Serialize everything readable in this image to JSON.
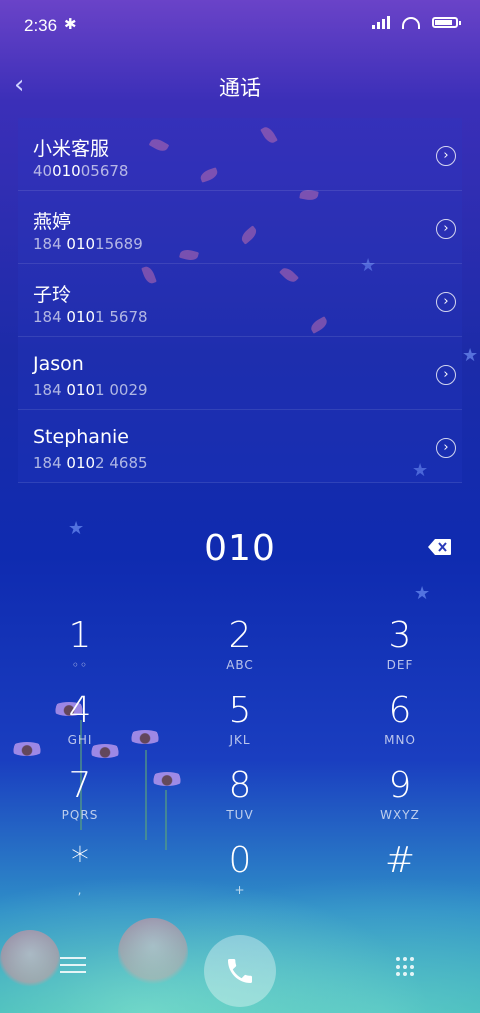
{
  "status_bar": {
    "time": "2:36",
    "bluetooth_glyph": "✱"
  },
  "header": {
    "back_glyph": "‹",
    "title": "通话"
  },
  "contacts": [
    {
      "name": "小米客服",
      "pre": "40",
      "match": "010",
      "post": "05678"
    },
    {
      "name": "燕婷",
      "pre": "184 ",
      "match": "010",
      "post": "15689"
    },
    {
      "name": "子玲",
      "pre": "184 ",
      "match": "010",
      "post": "1 5678"
    },
    {
      "name": "Jason",
      "pre": "184 ",
      "match": "010",
      "post": "1 0029"
    },
    {
      "name": "Stephanie",
      "pre": "184 ",
      "match": "010",
      "post": "2 4685"
    }
  ],
  "dial_input": "010",
  "keys": [
    {
      "digit": "1",
      "letters": "◦◦"
    },
    {
      "digit": "2",
      "letters": "ABC"
    },
    {
      "digit": "3",
      "letters": "DEF"
    },
    {
      "digit": "4",
      "letters": "GHI"
    },
    {
      "digit": "5",
      "letters": "JKL"
    },
    {
      "digit": "6",
      "letters": "MNO"
    },
    {
      "digit": "7",
      "letters": "PQRS"
    },
    {
      "digit": "8",
      "letters": "TUV"
    },
    {
      "digit": "9",
      "letters": "WXYZ"
    },
    {
      "digit": "*",
      "letters": ","
    },
    {
      "digit": "0",
      "letters": "+"
    },
    {
      "digit": "#",
      "letters": ""
    }
  ],
  "icons": {
    "back": "chevron-left-icon",
    "row_arrow": "chevron-right-circle-icon",
    "backspace": "backspace-icon",
    "menu": "menu-icon",
    "call": "phone-icon",
    "dialpad": "dialpad-icon"
  }
}
